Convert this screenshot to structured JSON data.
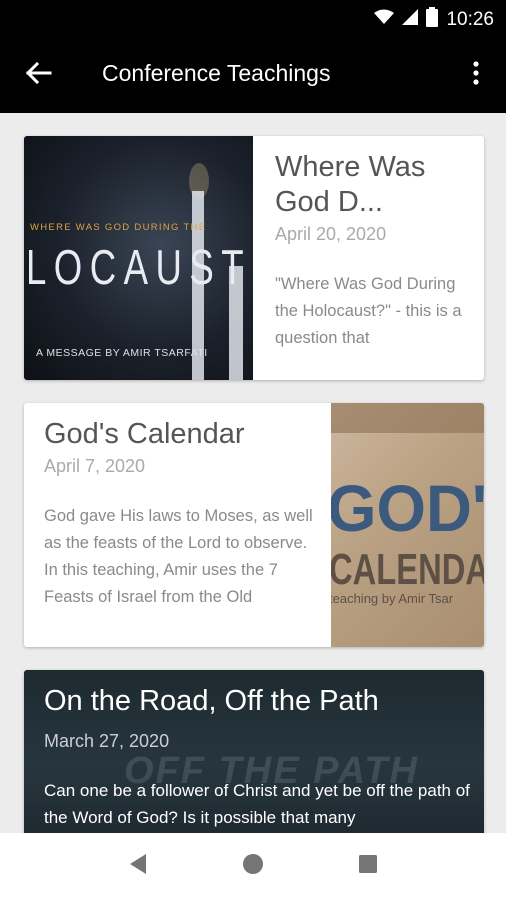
{
  "status_bar": {
    "time": "10:26",
    "icons": [
      "wifi-icon",
      "signal-icon",
      "battery-icon"
    ]
  },
  "app_bar": {
    "title": "Conference Teachings",
    "back_icon": "arrow-back-icon",
    "more_icon": "more-vert-icon"
  },
  "cards": [
    {
      "title": "Where Was God D...",
      "date": "April 20, 2020",
      "excerpt": "\"Where Was God During the Holocaust?\" - this is a question that",
      "thumbnail": {
        "line1": "WHERE WAS GOD DURING THE",
        "line2": "LOCAUST",
        "line3": "A MESSAGE BY AMIR TSARFATI"
      }
    },
    {
      "title": "God's Calendar",
      "date": "April 7, 2020",
      "excerpt": "God gave His laws to Moses, as well as the feasts of the Lord to observe. In this teaching, Amir uses the 7 Feasts of Israel from the Old Testament to",
      "thumbnail": {
        "line1": "GOD'",
        "line2": "CALENDA",
        "line3": "teaching by Amir Tsar"
      }
    },
    {
      "title": "On the Road, Off the Path",
      "date": "March 27, 2020",
      "excerpt": "Can one be a follower of Christ and yet be off the path of the Word of God? Is it possible that many",
      "background_text": "OFF THE PATH"
    }
  ],
  "nav_bar": {
    "icons": [
      "back-triangle-icon",
      "home-circle-icon",
      "recents-square-icon"
    ]
  },
  "colors": {
    "app_bar": "#000000",
    "background": "#ececec",
    "card": "#ffffff",
    "title_text": "#555555",
    "date_text": "#aaaaaa"
  }
}
